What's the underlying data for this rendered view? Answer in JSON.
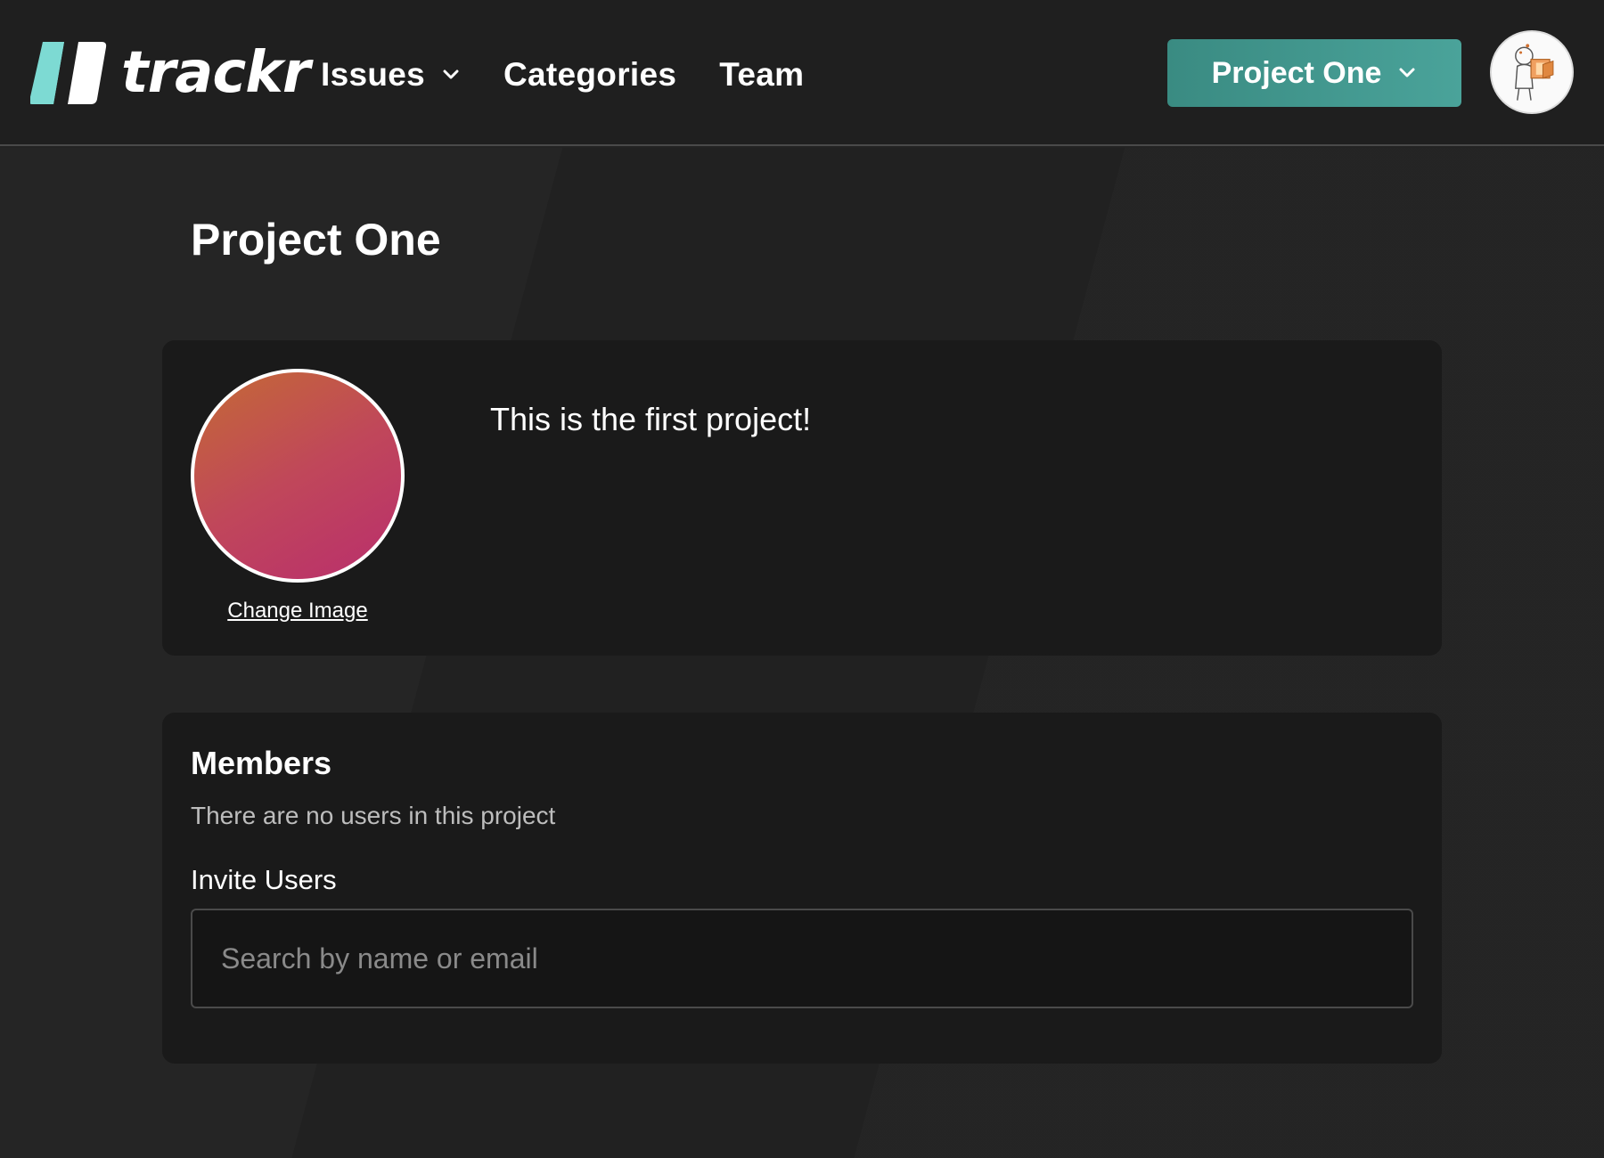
{
  "brand": {
    "name": "trackr",
    "accent_colors": [
      "#7ddad3",
      "#ffffff"
    ]
  },
  "nav": {
    "issues": "Issues",
    "categories": "Categories",
    "team": "Team"
  },
  "project_selector": {
    "label": "Project One",
    "color": "#3f978d"
  },
  "project": {
    "title": "Project One",
    "description": "This is the first project!",
    "change_image": "Change Image",
    "image_gradient": [
      "#c46a35",
      "#b92e6d"
    ]
  },
  "members": {
    "title": "Members",
    "empty_message": "There are no users in this project",
    "invite_label": "Invite Users",
    "search_placeholder": "Search by name or email"
  },
  "icons": {
    "issues_dropdown": "chevron-down-icon",
    "project_dropdown": "chevron-down-icon",
    "avatar": "user-avatar-illustration"
  }
}
